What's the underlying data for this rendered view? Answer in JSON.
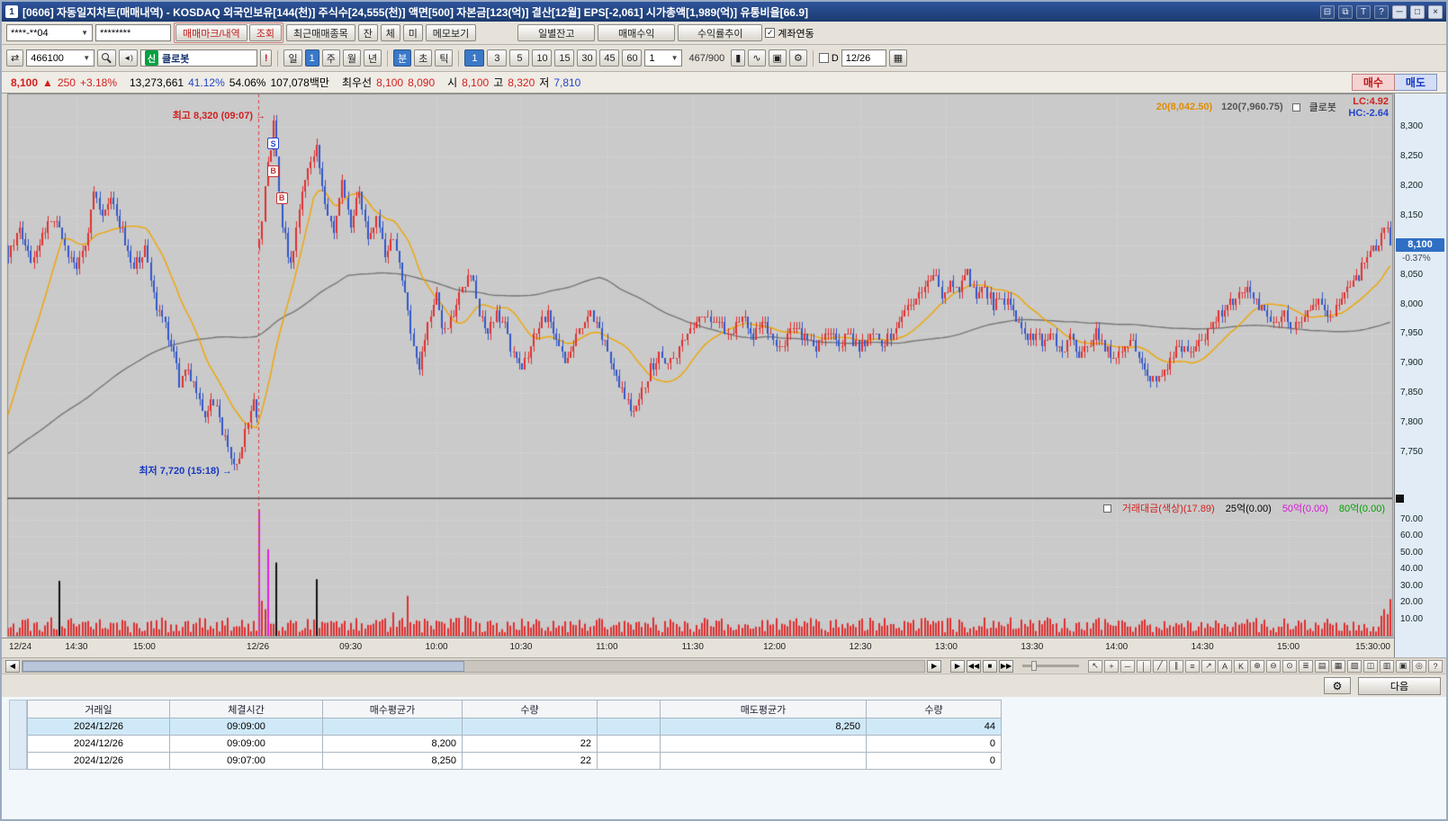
{
  "window": {
    "screen_no": "1",
    "title": "[0606] 자동일지차트(매매내역) - KOSDAQ 외국인보유[144(천)] 주식수[24,555(천)] 액면[500] 자본금[123(억)] 결산[12월] EPS[-2,061] 시가총액[1,989(억)] 유통비율[66.9]",
    "controls": {
      "dock": "⊟",
      "copy": "⧉",
      "font": "T",
      "help": "?",
      "minimize": "─",
      "maximize": "□",
      "close": "×"
    }
  },
  "toolbar_account": {
    "account": "****-**04",
    "password": "********",
    "mark_button": "매매마크/내역",
    "query_button": "조회",
    "recent_button": "최근매매종목",
    "small_buttons": [
      "잔",
      "체",
      "미"
    ],
    "memo_button": "메모보기",
    "daily_balance_button": "일별잔고",
    "trade_profit_button": "매매수익",
    "profit_trend_button": "수익률추이",
    "account_link_label": "계좌연동",
    "account_link_checked": "✓"
  },
  "toolbar_chart": {
    "transfer_icon": "⇄",
    "stock_code": "466100",
    "new_badge": "신",
    "stock_name": "클로봇",
    "alert_label": "!",
    "period_day": "일",
    "period_count": "1",
    "period_week": "주",
    "period_month": "월",
    "period_year": "년",
    "type_min": "분",
    "type_sec": "초",
    "type_tick": "틱",
    "minutes": [
      "1",
      "3",
      "5",
      "10",
      "15",
      "30",
      "45",
      "60"
    ],
    "custom_min": "1",
    "data_count": "467/900",
    "candle_icon": "▮",
    "ma_icon": "∿",
    "save_icon": "▣",
    "gear_icon": "⚙",
    "d_label": "D",
    "date": "12/26",
    "calendar_icon": "▦"
  },
  "price_bar": {
    "price": "8,100",
    "arrow": "▲",
    "change": "250",
    "change_pct": "+3.18%",
    "volume": "13,273,661",
    "pct1": "41.12%",
    "pct2": "54.06%",
    "amount": "107,078백만",
    "best_label": "최우선",
    "best_ask": "8,100",
    "best_bid": "8,090",
    "open_label": "시",
    "open": "8,100",
    "high_label": "고",
    "high": "8,320",
    "low_label": "저",
    "low": "7,810",
    "buy_button": "매수",
    "sell_button": "매도"
  },
  "chart": {
    "legend": {
      "ma20": "20(8,042.50)",
      "ma120": "120(7,960.75)",
      "name": "클로봇"
    },
    "lc": "LC:4.92",
    "hc": "HC:-2.64",
    "high_annotation": "최고 8,320 (09:07)",
    "low_annotation": "최저 7,720 (15:18)",
    "current_price": "8,100",
    "current_pct": "-0.37%",
    "volume_legend": {
      "main": "거래대금(색상)(17.89)",
      "t25": "25억(0.00)",
      "t50": "50억(0.00)",
      "t80": "80억(0.00)"
    }
  },
  "chart_data": {
    "type": "candlestick+volume",
    "symbol": "클로봇",
    "interval": "1분",
    "price_axis": [
      8300,
      8250,
      8200,
      8150,
      8100,
      8050,
      8000,
      7950,
      7900,
      7850,
      7800,
      7750
    ],
    "volume_axis": [
      70,
      60,
      50,
      40,
      30,
      20,
      10
    ],
    "price_range": [
      7673,
      8356
    ],
    "volume_range": [
      0,
      82
    ],
    "candle_count": 485,
    "session_break_index": 88,
    "day2_open": 8100,
    "day2_high": 8320,
    "day2_low": 7810,
    "last_close": 8100,
    "ma_seed": [
      7680,
      7810
    ],
    "extremes": {
      "high": {
        "index": 93,
        "price": 8320
      },
      "low": {
        "index": 80,
        "price": 7720
      }
    },
    "keypoints": [
      [
        0,
        8090
      ],
      [
        4,
        8130
      ],
      [
        8,
        8070
      ],
      [
        12,
        8110
      ],
      [
        16,
        8150
      ],
      [
        20,
        8100
      ],
      [
        24,
        8060
      ],
      [
        28,
        8120
      ],
      [
        30,
        8190
      ],
      [
        33,
        8150
      ],
      [
        36,
        8180
      ],
      [
        40,
        8120
      ],
      [
        44,
        8060
      ],
      [
        48,
        8090
      ],
      [
        52,
        8000
      ],
      [
        56,
        7950
      ],
      [
        60,
        7870
      ],
      [
        63,
        7900
      ],
      [
        66,
        7840
      ],
      [
        69,
        7810
      ],
      [
        72,
        7840
      ],
      [
        75,
        7780
      ],
      [
        78,
        7745
      ],
      [
        80,
        7725
      ],
      [
        82,
        7760
      ],
      [
        84,
        7800
      ],
      [
        86,
        7830
      ],
      [
        87,
        7815
      ],
      [
        88,
        8100
      ],
      [
        90,
        8200
      ],
      [
        93,
        8300
      ],
      [
        96,
        8140
      ],
      [
        99,
        8060
      ],
      [
        102,
        8160
      ],
      [
        105,
        8230
      ],
      [
        108,
        8270
      ],
      [
        111,
        8160
      ],
      [
        114,
        8120
      ],
      [
        117,
        8200
      ],
      [
        120,
        8140
      ],
      [
        123,
        8190
      ],
      [
        126,
        8100
      ],
      [
        129,
        8140
      ],
      [
        132,
        8080
      ],
      [
        135,
        8110
      ],
      [
        138,
        8040
      ],
      [
        141,
        7950
      ],
      [
        144,
        7900
      ],
      [
        147,
        7960
      ],
      [
        150,
        8010
      ],
      [
        153,
        7950
      ],
      [
        156,
        7990
      ],
      [
        159,
        8030
      ],
      [
        162,
        8050
      ],
      [
        165,
        7990
      ],
      [
        168,
        7950
      ],
      [
        171,
        7990
      ],
      [
        174,
        7960
      ],
      [
        177,
        7920
      ],
      [
        180,
        7890
      ],
      [
        183,
        7930
      ],
      [
        186,
        7960
      ],
      [
        189,
        7985
      ],
      [
        192,
        7940
      ],
      [
        195,
        7910
      ],
      [
        198,
        7930
      ],
      [
        201,
        7960
      ],
      [
        204,
        7990
      ],
      [
        207,
        7950
      ],
      [
        210,
        7920
      ],
      [
        213,
        7880
      ],
      [
        216,
        7845
      ],
      [
        219,
        7820
      ],
      [
        222,
        7850
      ],
      [
        225,
        7890
      ],
      [
        228,
        7915
      ],
      [
        231,
        7890
      ],
      [
        234,
        7920
      ],
      [
        237,
        7945
      ],
      [
        240,
        7965
      ],
      [
        243,
        7990
      ],
      [
        246,
        7960
      ],
      [
        249,
        7975
      ],
      [
        252,
        7945
      ],
      [
        255,
        7960
      ],
      [
        258,
        7975
      ],
      [
        261,
        7950
      ],
      [
        264,
        7970
      ],
      [
        267,
        7945
      ],
      [
        270,
        7925
      ],
      [
        273,
        7945
      ],
      [
        276,
        7965
      ],
      [
        279,
        7940
      ],
      [
        282,
        7925
      ],
      [
        285,
        7940
      ],
      [
        288,
        7955
      ],
      [
        291,
        7935
      ],
      [
        294,
        7950
      ],
      [
        297,
        7930
      ],
      [
        300,
        7940
      ],
      [
        303,
        7955
      ],
      [
        306,
        7935
      ],
      [
        309,
        7950
      ],
      [
        312,
        7970
      ],
      [
        315,
        7995
      ],
      [
        318,
        8015
      ],
      [
        321,
        8040
      ],
      [
        324,
        8055
      ],
      [
        327,
        8020
      ],
      [
        330,
        8040
      ],
      [
        333,
        8025
      ],
      [
        336,
        8055
      ],
      [
        339,
        8010
      ],
      [
        342,
        8035
      ],
      [
        345,
        8000
      ],
      [
        348,
        8015
      ],
      [
        351,
        7990
      ],
      [
        354,
        7965
      ],
      [
        357,
        7940
      ],
      [
        360,
        7955
      ],
      [
        363,
        7930
      ],
      [
        366,
        7945
      ],
      [
        369,
        7920
      ],
      [
        372,
        7940
      ],
      [
        375,
        7915
      ],
      [
        378,
        7930
      ],
      [
        381,
        7950
      ],
      [
        384,
        7930
      ],
      [
        387,
        7910
      ],
      [
        390,
        7925
      ],
      [
        393,
        7940
      ],
      [
        396,
        7905
      ],
      [
        399,
        7880
      ],
      [
        402,
        7870
      ],
      [
        405,
        7890
      ],
      [
        408,
        7910
      ],
      [
        411,
        7930
      ],
      [
        414,
        7915
      ],
      [
        417,
        7935
      ],
      [
        420,
        7955
      ],
      [
        423,
        7975
      ],
      [
        426,
        7995
      ],
      [
        429,
        8010
      ],
      [
        432,
        8025
      ],
      [
        435,
        8030
      ],
      [
        438,
        8000
      ],
      [
        441,
        7980
      ],
      [
        444,
        7965
      ],
      [
        447,
        7985
      ],
      [
        450,
        7960
      ],
      [
        453,
        7975
      ],
      [
        456,
        7990
      ],
      [
        459,
        8005
      ],
      [
        462,
        7980
      ],
      [
        465,
        7995
      ],
      [
        468,
        8015
      ],
      [
        471,
        8035
      ],
      [
        474,
        8060
      ],
      [
        477,
        8080
      ],
      [
        480,
        8110
      ],
      [
        483,
        8130
      ],
      [
        484,
        8100
      ]
    ],
    "volume_spikes": [
      [
        18,
        33
      ],
      [
        88,
        76
      ],
      [
        89,
        21
      ],
      [
        90,
        16
      ],
      [
        91,
        52
      ],
      [
        94,
        44
      ],
      [
        108,
        34
      ],
      [
        135,
        14
      ],
      [
        140,
        24
      ],
      [
        160,
        12
      ],
      [
        481,
        12
      ],
      [
        482,
        16
      ],
      [
        483,
        13
      ],
      [
        484,
        22
      ]
    ],
    "markers": [
      {
        "label": "S",
        "i": 93,
        "price": 8272,
        "color": "#2847c8"
      },
      {
        "label": "B",
        "i": 93,
        "price": 8226,
        "color": "#c83232"
      },
      {
        "label": "B",
        "i": 96,
        "price": 8180,
        "color": "#c83232"
      }
    ],
    "time_labels": [
      {
        "t": "12/24",
        "f": 0.004
      },
      {
        "t": "14:30",
        "f": 0.05
      },
      {
        "t": "15:00",
        "f": 0.099
      },
      {
        "t": "12/26",
        "f": 0.181
      },
      {
        "t": "09:30",
        "f": 0.248
      },
      {
        "t": "10:00",
        "f": 0.31
      },
      {
        "t": "10:30",
        "f": 0.371
      },
      {
        "t": "11:00",
        "f": 0.433
      },
      {
        "t": "11:30",
        "f": 0.495
      },
      {
        "t": "12:00",
        "f": 0.554
      },
      {
        "t": "12:30",
        "f": 0.616
      },
      {
        "t": "13:00",
        "f": 0.678
      },
      {
        "t": "13:30",
        "f": 0.74
      },
      {
        "t": "14:00",
        "f": 0.801
      },
      {
        "t": "14:30",
        "f": 0.863
      },
      {
        "t": "15:00",
        "f": 0.925
      },
      {
        "t": "15:30:00",
        "f": 0.985
      }
    ],
    "colors": {
      "up": "#e03030",
      "down": "#3356c8",
      "ma_short": "#f0a500",
      "ma_long": "#777777",
      "session_line": "#e04040",
      "vol_low": "#e03030",
      "vol_mid": "#111111",
      "vol_high": "#e020e0",
      "vol_top": "#00a000",
      "grid": "#dedede",
      "plot_bg": "#cacaca",
      "current_tag_bg": "#2f6fc4"
    }
  },
  "tools": {
    "nav": [
      {
        "name": "play",
        "glyph": "▶"
      },
      {
        "name": "rewind",
        "glyph": "◀◀"
      },
      {
        "name": "stop",
        "glyph": "■"
      },
      {
        "name": "fast-forward",
        "glyph": "▶▶"
      }
    ],
    "icons": [
      {
        "name": "grab",
        "glyph": "↖"
      },
      {
        "name": "crosshair",
        "glyph": "+"
      },
      {
        "name": "horizontal-line",
        "glyph": "─"
      },
      {
        "name": "vertical-line",
        "glyph": "│"
      },
      {
        "name": "trendline",
        "glyph": "╱"
      },
      {
        "name": "parallel-channel",
        "glyph": "∥"
      },
      {
        "name": "fibonacci",
        "glyph": "≡"
      },
      {
        "name": "arrow-tool",
        "glyph": "↗"
      },
      {
        "name": "text-tool",
        "glyph": "A"
      },
      {
        "name": "k-tool",
        "glyph": "K"
      },
      {
        "name": "zoom-in",
        "glyph": "⊕"
      },
      {
        "name": "zoom-out",
        "glyph": "⊖"
      },
      {
        "name": "zoom-reset",
        "glyph": "⊙"
      },
      {
        "name": "indicator-list",
        "glyph": "≣"
      },
      {
        "name": "pattern",
        "glyph": "▤"
      },
      {
        "name": "grid-style",
        "glyph": "▦"
      },
      {
        "name": "panel-layout",
        "glyph": "▧"
      },
      {
        "name": "compare",
        "glyph": "◫"
      },
      {
        "name": "print",
        "glyph": "▥"
      },
      {
        "name": "save-image",
        "glyph": "▣"
      },
      {
        "name": "capture",
        "glyph": "◎"
      },
      {
        "name": "help-tool",
        "glyph": "?"
      }
    ],
    "gear": "⚙",
    "next_button": "다음"
  },
  "table": {
    "headers": [
      "거래일",
      "체결시간",
      "매수평균가",
      "수량",
      "",
      "매도평균가",
      "수량"
    ],
    "rows": [
      [
        "2024/12/26",
        "09:09:00",
        "",
        "",
        "",
        "8,250",
        "44"
      ],
      [
        "2024/12/26",
        "09:09:00",
        "8,200",
        "22",
        "",
        "",
        "0"
      ],
      [
        "2024/12/26",
        "09:07:00",
        "8,250",
        "22",
        "",
        "",
        "0"
      ]
    ]
  }
}
